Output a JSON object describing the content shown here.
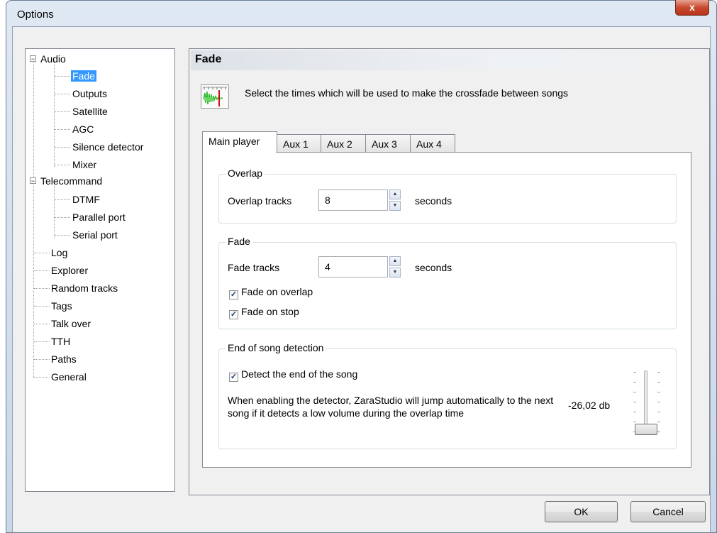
{
  "window": {
    "title": "Options",
    "close_glyph": "x"
  },
  "tree": {
    "items": [
      {
        "label": "Audio",
        "expander": "−"
      },
      {
        "label": "Fade"
      },
      {
        "label": "Outputs"
      },
      {
        "label": "Satellite"
      },
      {
        "label": "AGC"
      },
      {
        "label": "Silence detector"
      },
      {
        "label": "Mixer"
      },
      {
        "label": "Telecommand",
        "expander": "−"
      },
      {
        "label": "DTMF"
      },
      {
        "label": "Parallel port"
      },
      {
        "label": "Serial port"
      },
      {
        "label": "Log"
      },
      {
        "label": "Explorer"
      },
      {
        "label": "Random tracks"
      },
      {
        "label": "Tags"
      },
      {
        "label": "Talk over"
      },
      {
        "label": "TTH"
      },
      {
        "label": "Paths"
      },
      {
        "label": "General"
      }
    ],
    "selected": "Fade"
  },
  "panel": {
    "title": "Fade",
    "icon": "waveform-crossfade-icon",
    "description": "Select the times which will be used to make the crossfade between songs"
  },
  "tabs": [
    {
      "label": "Main player",
      "active": true
    },
    {
      "label": "Aux 1"
    },
    {
      "label": "Aux 2"
    },
    {
      "label": "Aux 3"
    },
    {
      "label": "Aux 4"
    }
  ],
  "overlap": {
    "group_title": "Overlap",
    "label": "Overlap tracks",
    "value": "8",
    "unit": "seconds"
  },
  "fade": {
    "group_title": "Fade",
    "label": "Fade tracks",
    "value": "4",
    "unit": "seconds",
    "fade_on_overlap": {
      "label": "Fade on overlap",
      "checked": true
    },
    "fade_on_stop": {
      "label": "Fade on stop",
      "checked": true
    }
  },
  "end_of_song": {
    "group_title": "End of song detection",
    "detect": {
      "label": "Detect the end of the song",
      "checked": true
    },
    "description": "When enabling the detector, ZaraStudio will jump automatically to the next song if it detects a low volume during the overlap time",
    "level": "-26,02 db"
  },
  "buttons": {
    "ok": "OK",
    "cancel": "Cancel"
  },
  "check_glyph": "✓",
  "spin_up": "▲",
  "spin_down": "▼"
}
